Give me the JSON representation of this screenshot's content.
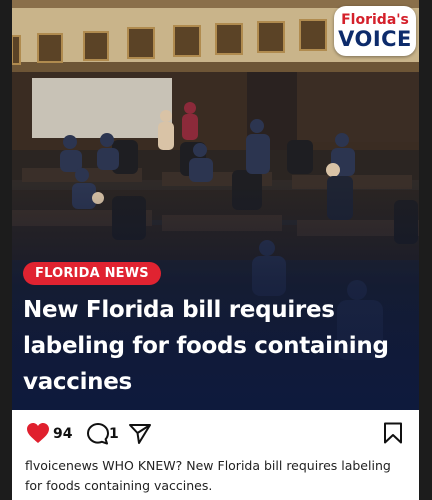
{
  "brand": {
    "logo_top": "Florida's",
    "logo_bottom": "VOICE"
  },
  "post": {
    "category": "FLORIDA NEWS",
    "headline": "New Florida bill requires labeling for foods containing vaccines",
    "likes": "94",
    "comments": "1",
    "caption": "flvoicenews WHO KNEW? New Florida bill requires labeling for foods containing vaccines."
  },
  "icons": {
    "like": "heart-icon",
    "comment": "comment-icon",
    "share": "send-icon",
    "save": "bookmark-icon"
  },
  "colors": {
    "accent_red": "#e02331",
    "brand_navy": "#0d2b6b",
    "heart_red": "#e0202e"
  }
}
